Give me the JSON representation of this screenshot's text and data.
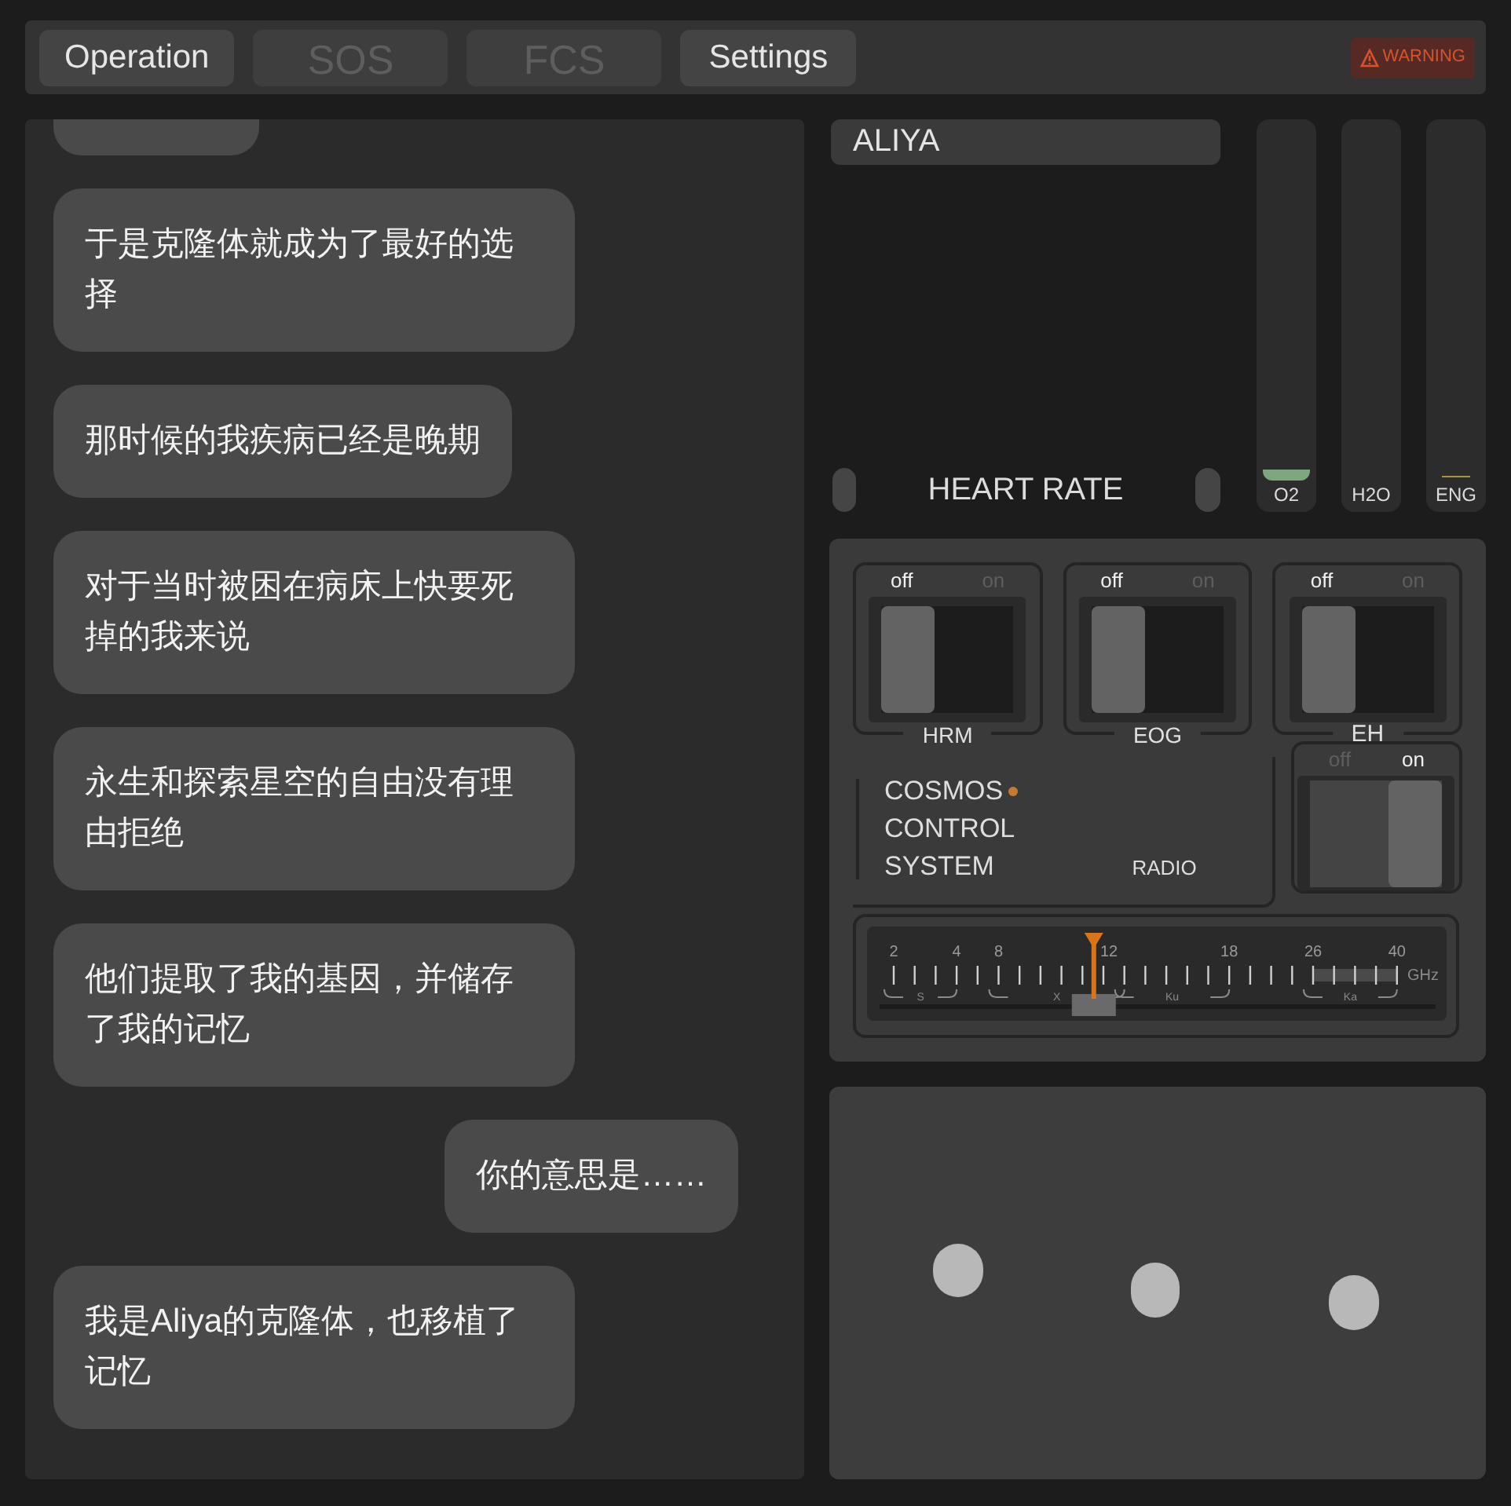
{
  "tabs": [
    {
      "label": "Operation",
      "disabled": false
    },
    {
      "label": "SOS",
      "disabled": true
    },
    {
      "label": "FCS",
      "disabled": true
    },
    {
      "label": "Settings",
      "disabled": false
    }
  ],
  "warning": {
    "label": "WARNING"
  },
  "chat": {
    "messages": [
      {
        "outgoing": false,
        "text": "于是克隆体就成为了最好的选择"
      },
      {
        "outgoing": false,
        "text": "那时候的我疾病已经是晚期"
      },
      {
        "outgoing": false,
        "text": "对于当时被困在病床上快要死掉的我来说"
      },
      {
        "outgoing": false,
        "text": "永生和探索星空的自由没有理由拒绝"
      },
      {
        "outgoing": false,
        "text": "他们提取了我的基因，并储存了我的记忆"
      },
      {
        "outgoing": true,
        "text": "你的意思是……"
      },
      {
        "outgoing": false,
        "text": "我是Aliya的克隆体，也移植了记忆"
      }
    ]
  },
  "monitor": {
    "name": "ALIYA",
    "caption": "HEART RATE",
    "gauges": [
      {
        "label": "O2",
        "level": 0.03,
        "color": "#7fa77f"
      },
      {
        "label": "H2O"
      },
      {
        "label": "ENG"
      }
    ]
  },
  "controls": {
    "switches": [
      {
        "label": "HRM",
        "off_label": "off",
        "on_label": "on",
        "on": false
      },
      {
        "label": "EOG",
        "off_label": "off",
        "on_label": "on",
        "on": false
      },
      {
        "label": "EH",
        "off_label": "off",
        "on_label": "on",
        "on": false
      }
    ],
    "title_lines": [
      "COSMOS",
      "CONTROL",
      "SYSTEM"
    ],
    "radio": {
      "label": "RADIO",
      "off_label": "off",
      "on_label": "on",
      "on": true
    },
    "tuner": {
      "scale": [
        "2",
        "4",
        "8",
        "12",
        "18",
        "26",
        "40"
      ],
      "unit": "GHz",
      "bands": [
        "S",
        "X",
        "Ku",
        "Ka"
      ],
      "level": 0.39
    }
  }
}
